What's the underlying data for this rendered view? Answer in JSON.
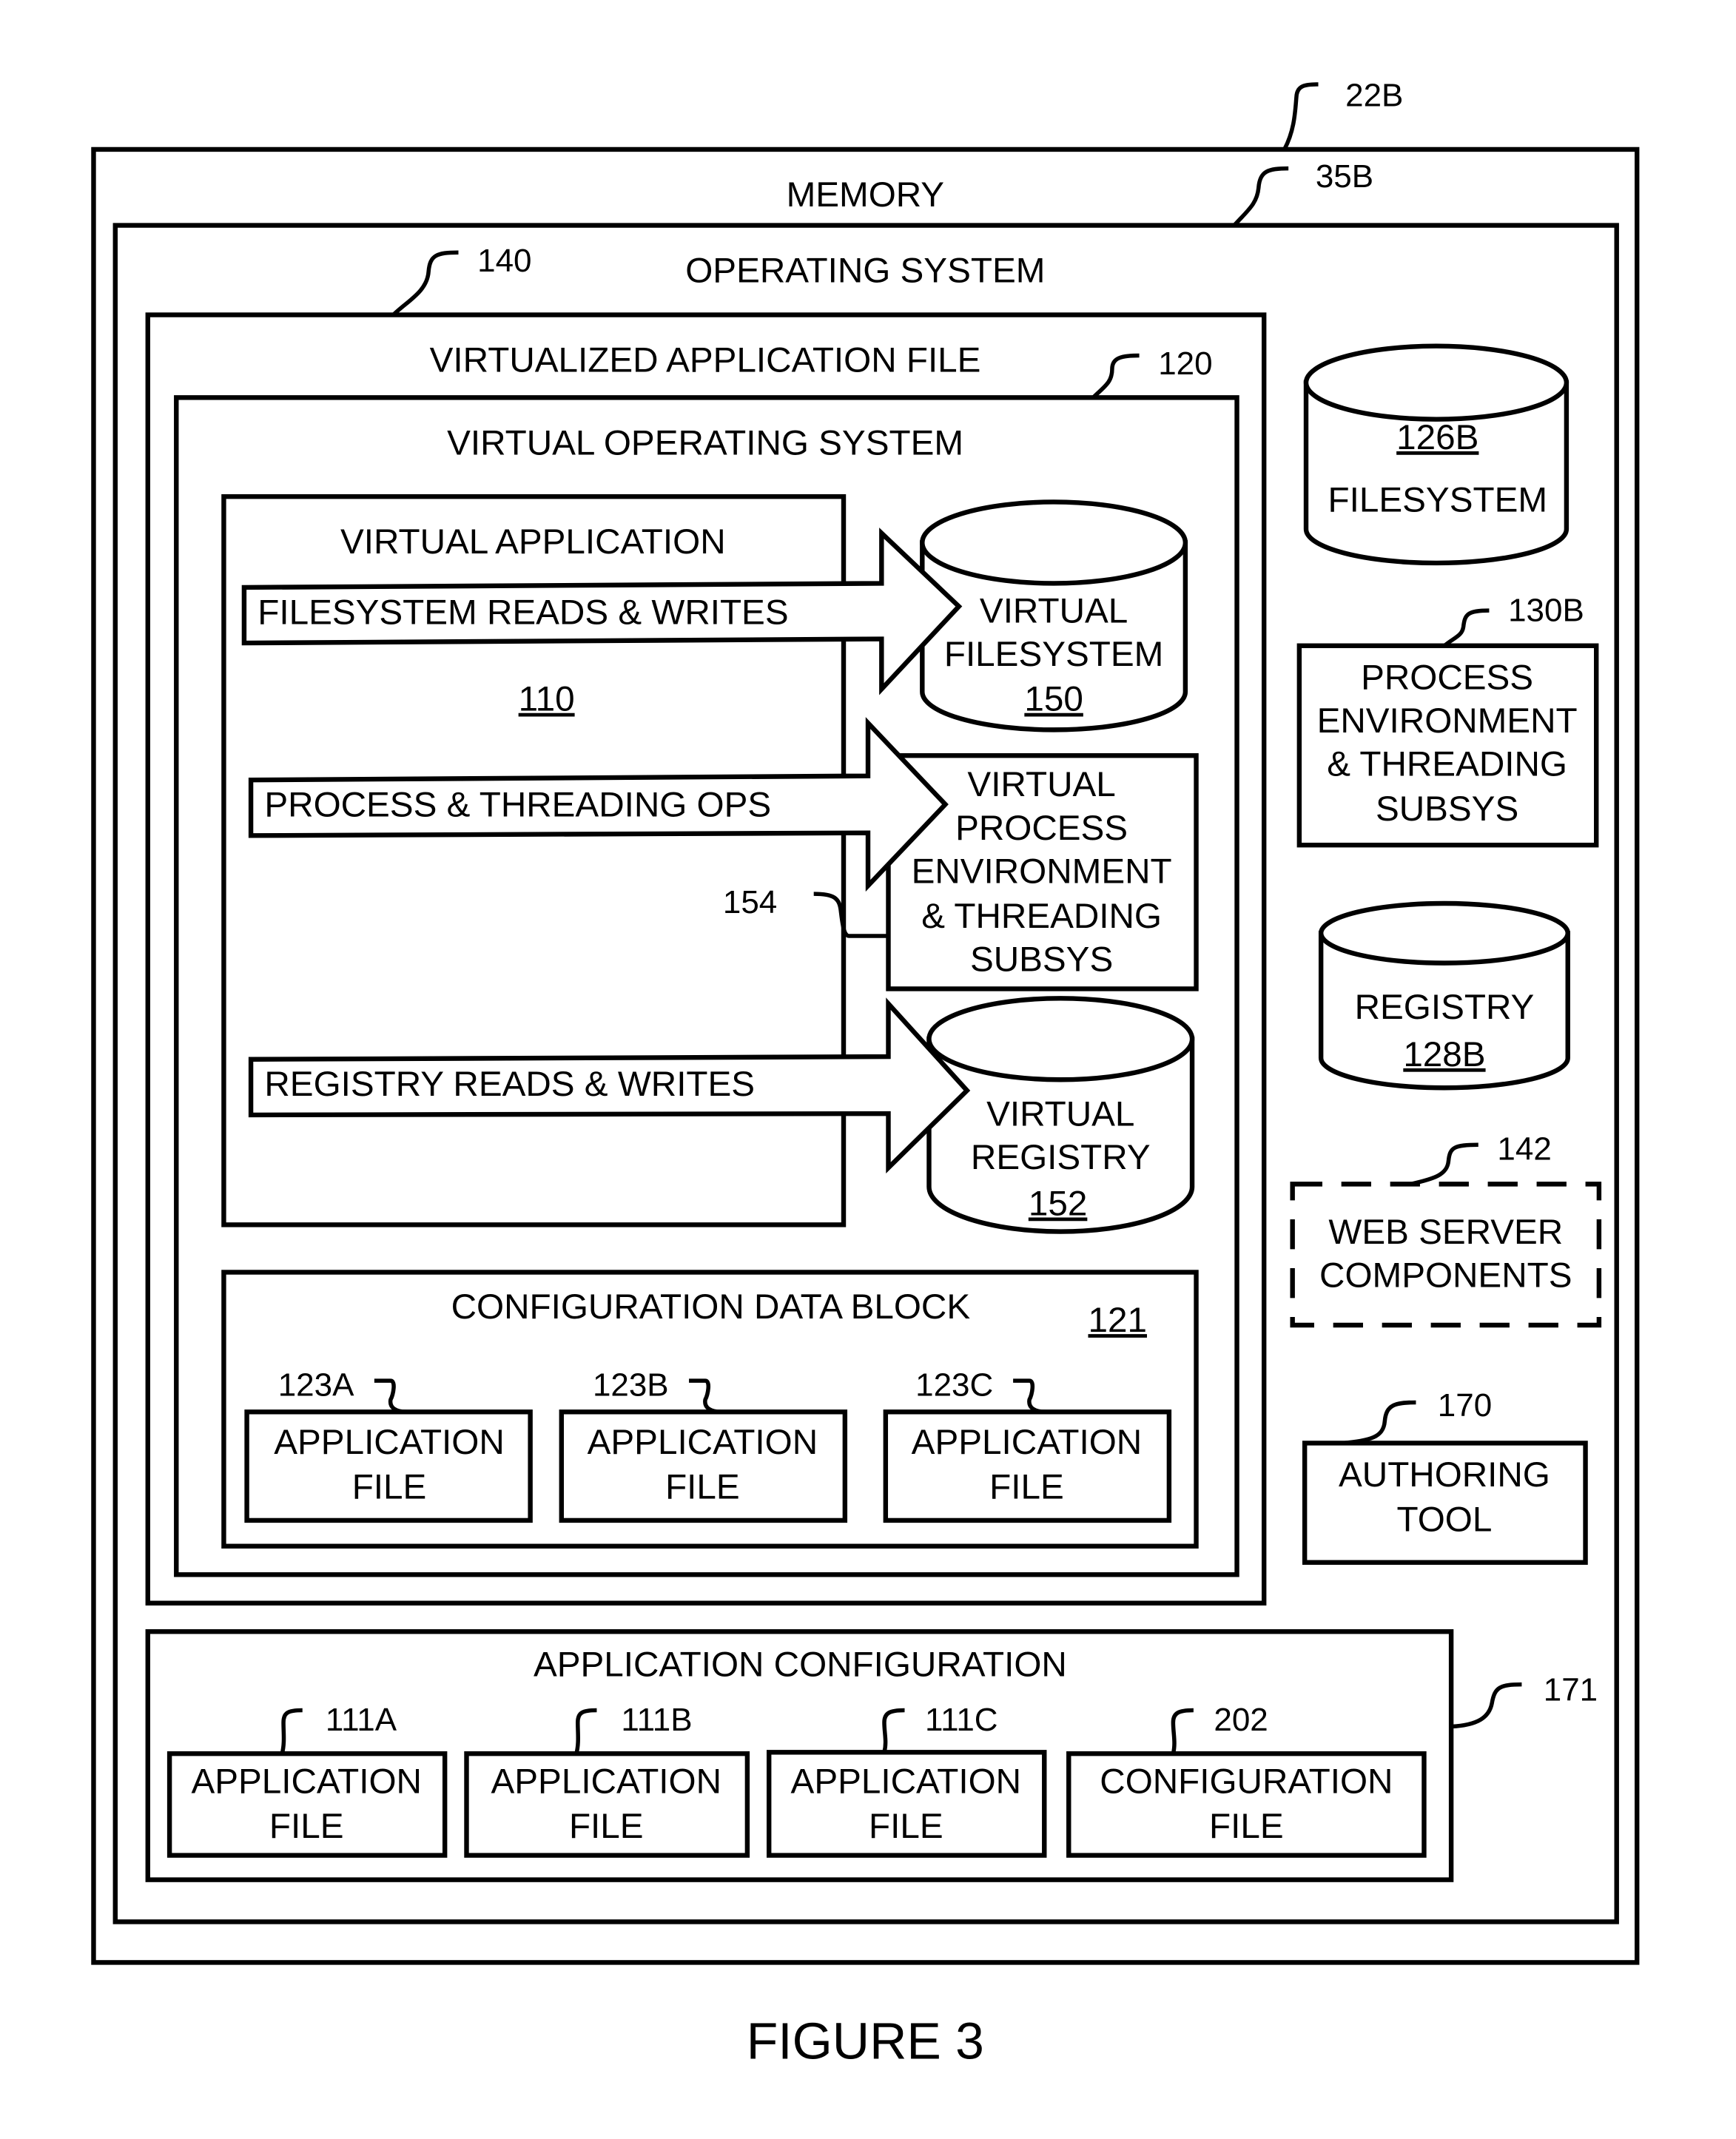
{
  "figure": {
    "caption": "FIGURE 3",
    "memory": {
      "label": "MEMORY",
      "ref": "22B"
    },
    "operating_system": {
      "label": "OPERATING SYSTEM",
      "ref": "35B"
    },
    "virtualized_app_file": {
      "label": "VIRTUALIZED APPLICATION FILE",
      "ref": "140"
    },
    "virtual_os": {
      "label": "VIRTUAL OPERATING SYSTEM",
      "ref": "120"
    },
    "virtual_application": {
      "label": "VIRTUAL APPLICATION",
      "ref": "110"
    },
    "arrows": [
      {
        "label": "FILESYSTEM READS & WRITES"
      },
      {
        "label": "PROCESS & THREADING OPS"
      },
      {
        "label": "REGISTRY READS & WRITES"
      }
    ],
    "virtual_filesystem": {
      "lines": [
        "VIRTUAL",
        "FILESYSTEM"
      ],
      "ref": "150"
    },
    "virtual_process": {
      "lines": [
        "VIRTUAL",
        "PROCESS",
        "ENVIRONMENT",
        "& THREADING",
        "SUBSYS"
      ],
      "ref": "154"
    },
    "virtual_registry": {
      "lines": [
        "VIRTUAL",
        "REGISTRY"
      ],
      "ref": "152"
    },
    "config_data_block": {
      "label": "CONFIGURATION DATA BLOCK",
      "ref": "121",
      "files": [
        {
          "ref": "123A",
          "lines": [
            "APPLICATION",
            "FILE"
          ]
        },
        {
          "ref": "123B",
          "lines": [
            "APPLICATION",
            "FILE"
          ]
        },
        {
          "ref": "123C",
          "lines": [
            "APPLICATION",
            "FILE"
          ]
        }
      ]
    },
    "filesystem": {
      "label": "FILESYSTEM",
      "ref": "126B"
    },
    "process_env": {
      "lines": [
        "PROCESS",
        "ENVIRONMENT",
        "& THREADING",
        "SUBSYS"
      ],
      "ref": "130B"
    },
    "registry": {
      "label": "REGISTRY",
      "ref": "128B"
    },
    "web_server": {
      "lines": [
        "WEB SERVER",
        "COMPONENTS"
      ],
      "ref": "142"
    },
    "authoring_tool": {
      "lines": [
        "AUTHORING",
        "TOOL"
      ],
      "ref": "170"
    },
    "app_configuration": {
      "label": "APPLICATION CONFIGURATION",
      "ref": "171",
      "files": [
        {
          "ref": "111A",
          "lines": [
            "APPLICATION",
            "FILE"
          ]
        },
        {
          "ref": "111B",
          "lines": [
            "APPLICATION",
            "FILE"
          ]
        },
        {
          "ref": "111C",
          "lines": [
            "APPLICATION",
            "FILE"
          ]
        },
        {
          "ref": "202",
          "lines": [
            "CONFIGURATION",
            "FILE"
          ]
        }
      ]
    }
  }
}
